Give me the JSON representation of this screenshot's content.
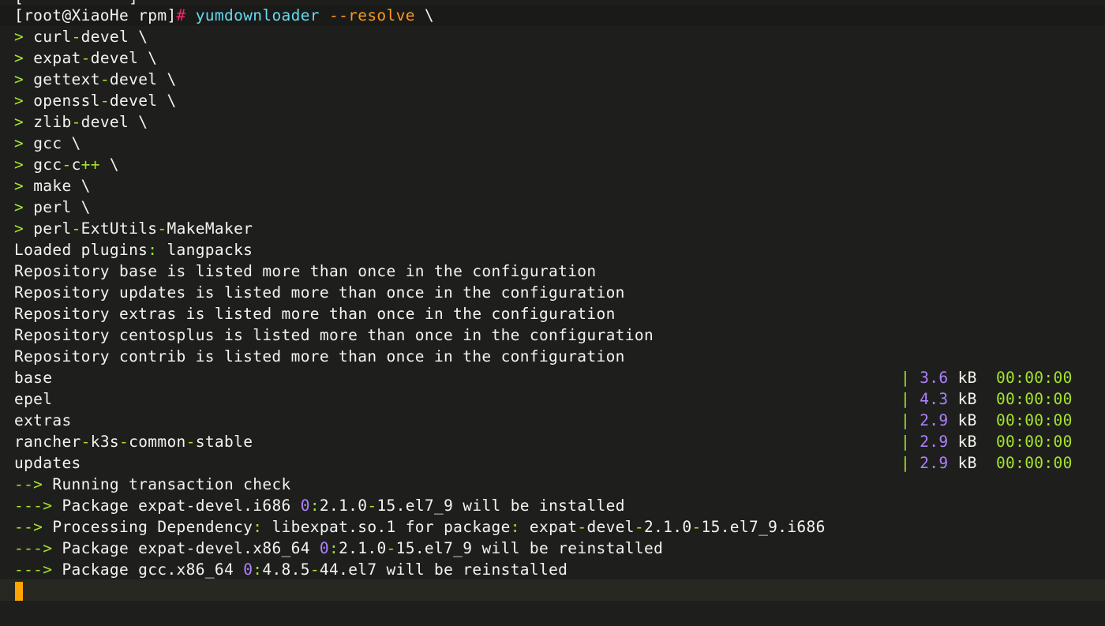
{
  "terminal": {
    "prev_line_stub": "[           ]",
    "prompt": {
      "user_host_dir": "[root@XiaoHe rpm]",
      "symbol": "#",
      "command": "yumdownloader",
      "option": "--resolve",
      "continuation": "\\"
    },
    "continuation_prompt": ">",
    "packages": [
      {
        "parts": [
          "curl",
          "-",
          "devel"
        ],
        "tail": " \\"
      },
      {
        "parts": [
          "expat",
          "-",
          "devel"
        ],
        "tail": " \\"
      },
      {
        "parts": [
          "gettext",
          "-",
          "devel"
        ],
        "tail": " \\"
      },
      {
        "parts": [
          "openssl",
          "-",
          "devel"
        ],
        "tail": " \\"
      },
      {
        "parts": [
          "zlib",
          "-",
          "devel"
        ],
        "tail": " \\"
      },
      {
        "parts": [
          "gcc"
        ],
        "tail": " \\"
      },
      {
        "parts": [
          "gcc",
          "-",
          "c",
          "++"
        ],
        "tail": " \\"
      },
      {
        "parts": [
          "make"
        ],
        "tail": " \\"
      },
      {
        "parts": [
          "perl"
        ],
        "tail": " \\"
      },
      {
        "parts": [
          "perl",
          "-",
          "ExtUtils",
          "-",
          "MakeMaker"
        ],
        "tail": ""
      }
    ],
    "loaded_plugins": {
      "label": "Loaded plugins",
      "colon": ":",
      "value": " langpacks"
    },
    "repo_warnings": [
      "Repository base is listed more than once in the configuration",
      "Repository updates is listed more than once in the configuration",
      "Repository extras is listed more than once in the configuration",
      "Repository centosplus is listed more than once in the configuration",
      "Repository contrib is listed more than once in the configuration"
    ],
    "repos": [
      {
        "name": "base",
        "size": "3.6",
        "unit": "kB",
        "time": "00:00:00"
      },
      {
        "name": "epel",
        "size": "4.3",
        "unit": "kB",
        "time": "00:00:00"
      },
      {
        "name": "extras",
        "size": "2.9",
        "unit": "kB",
        "time": "00:00:00"
      },
      {
        "name": "rancher-k3s-common-stable",
        "size": "2.9",
        "unit": "kB",
        "time": "00:00:00"
      },
      {
        "name": "updates",
        "size": "2.9",
        "unit": "kB",
        "time": "00:00:00"
      }
    ],
    "transaction": [
      {
        "arrow": "-->",
        "text": " Running transaction check"
      },
      {
        "arrow": "--->",
        "text": " Package expat-devel.i686 ",
        "epoch": "0",
        "rest": ":2.1.0-15.el7_9 will be installed"
      },
      {
        "arrow": "-->",
        "text": " Processing Dependency",
        "colon": ":",
        "mid": " libexpat.so.1 for package",
        "colon2": ":",
        "rest": " expat-devel-2.1.0-15.el7_9.i686"
      },
      {
        "arrow": "--->",
        "text": " Package expat-devel.x86_64 ",
        "epoch": "0",
        "rest": ":2.1.0-15.el7_9 will be reinstalled"
      },
      {
        "arrow": "--->",
        "text": " Package gcc.x86_64 ",
        "epoch": "0",
        "rest": ":4.8.5-44.el7 will be reinstalled"
      }
    ],
    "colors": {
      "background": "#1e1f1c",
      "foreground": "#f4f4ef",
      "prompt_symbol": "#f92672",
      "command": "#66d9ef",
      "option": "#fd971f",
      "punctuation": "#a6e22e",
      "numbers": "#ae81ff",
      "cursor": "#ffa500"
    }
  }
}
